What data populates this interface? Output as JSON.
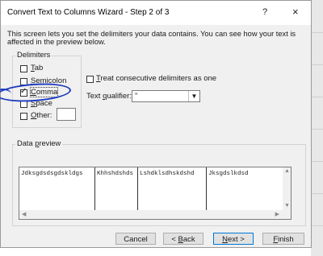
{
  "window": {
    "title": "Convert Text to Columns Wizard - Step 2 of 3",
    "help": "?",
    "close": "×"
  },
  "intro": "This screen lets you set the delimiters your data contains.  You can see how your text is affected in the preview below.",
  "delimiters": {
    "group_label": "Delimiters",
    "tab": {
      "label": "Tab",
      "checked": false
    },
    "semicolon": {
      "label": "Semicolon",
      "checked": false
    },
    "comma": {
      "label": "Comma",
      "checked": true
    },
    "space": {
      "label": "Space",
      "checked": false
    },
    "other": {
      "label": "Other:",
      "checked": false,
      "value": ""
    }
  },
  "consecutive": {
    "label": "Treat consecutive delimiters as one",
    "checked": false
  },
  "qualifier": {
    "label": "Text qualifier:",
    "value": "\""
  },
  "preview": {
    "group_label": "Data preview",
    "columns": [
      "Jdksgdsdsgdskldgs",
      "Khhshdshds",
      "Lshdklsdhskdshd",
      "Jksgdslkdsd"
    ]
  },
  "buttons": {
    "cancel": "Cancel",
    "back": "< Back",
    "next": "Next >",
    "finish": "Finish"
  }
}
